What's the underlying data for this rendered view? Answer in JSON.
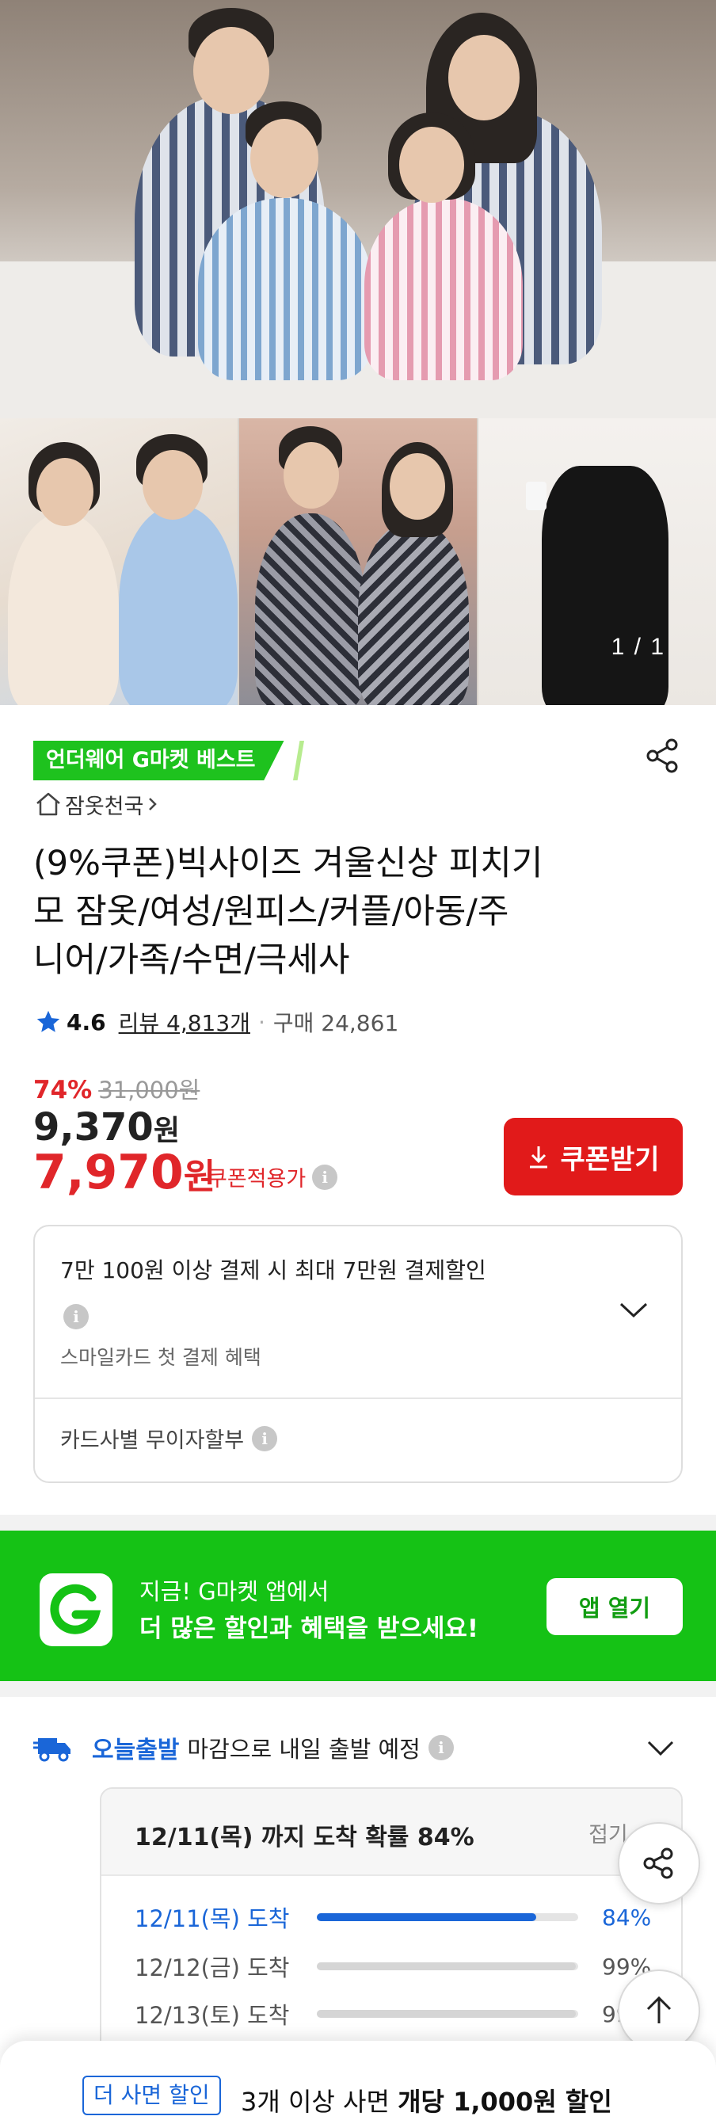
{
  "gallery": {
    "page_indicator": "1 / 1"
  },
  "product": {
    "badge": "언더웨어 G마켓 베스트",
    "shop_name": "잠옷천국",
    "title_lines": [
      "(9%쿠폰)빅사이즈 겨울신상 피치기",
      "모 잠옷/여성/원피스/커플/아동/주",
      "니어/가족/수면/극세사"
    ],
    "rating": "4.6",
    "reviews": "리뷰 4,813개",
    "purchases": "구매 24,861",
    "discount": "74%",
    "original_price": "31,000원",
    "price": "9,370",
    "price_unit": "원",
    "coupon_price": "7,970",
    "coupon_price_unit": "원",
    "coupon_label": "쿠폰적용가",
    "coupon_button": "쿠폰받기"
  },
  "payment": {
    "main": "7만 100원 이상 결제 시 최대 7만원 결제할인",
    "sub": "스마일카드 첫 결제 혜택",
    "installment": "카드사별 무이자할부"
  },
  "app_banner": {
    "line1": "지금! G마켓 앱에서",
    "line2": "더 많은 할인과 혜택을 받으세요!",
    "button": "앱 열기"
  },
  "delivery": {
    "today_label": "오늘출발",
    "deadline": "마감으로 내일 출발 예정",
    "prob_title": "12/11(목) 까지 도착 확률 84%",
    "collapse": "접기",
    "rows": [
      {
        "label": "12/11(목) 도착",
        "pct": "84%",
        "value": 0.84
      },
      {
        "label": "12/12(금) 도착",
        "pct": "99%",
        "value": 0.99
      },
      {
        "label": "12/13(토) 도착",
        "pct": "99%",
        "value": 0.99
      }
    ]
  },
  "bulk": {
    "tag": "더 사면 할인",
    "text_prefix": "3개 이상 사면 ",
    "text_bold": "개당 1,000원 할인"
  },
  "colors": {
    "accent_green": "#15c215",
    "sale_red": "#e0262a",
    "delivery_blue": "#1a66d8"
  }
}
